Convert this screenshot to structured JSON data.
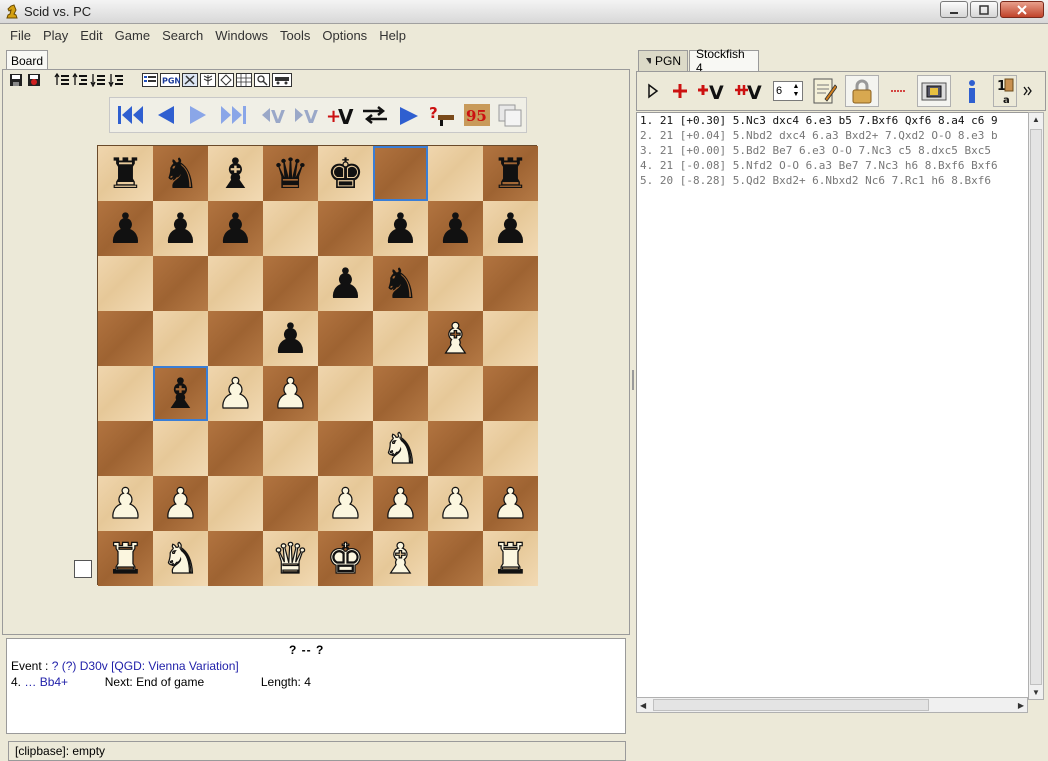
{
  "window": {
    "title": "Scid vs. PC"
  },
  "menu": [
    "File",
    "Play",
    "Edit",
    "Game",
    "Search",
    "Windows",
    "Tools",
    "Options",
    "Help"
  ],
  "left_tab": "Board",
  "board": {
    "rows": [
      [
        "br",
        "bn",
        "bb",
        "bq",
        "bk",
        "",
        "",
        "br"
      ],
      [
        "bp",
        "bp",
        "bp",
        "",
        "",
        "bp",
        "bp",
        "bp"
      ],
      [
        "",
        "",
        "",
        "",
        "bp",
        "bn",
        "",
        ""
      ],
      [
        "",
        "",
        "",
        "bp",
        "",
        "",
        "wb",
        ""
      ],
      [
        "",
        "bb",
        "wp",
        "wp",
        "",
        "",
        "",
        ""
      ],
      [
        "",
        "",
        "",
        "",
        "",
        "wn",
        "",
        ""
      ],
      [
        "wp",
        "wp",
        "",
        "",
        "wp",
        "wp",
        "wp",
        "wp"
      ],
      [
        "wr",
        "wn",
        "",
        "wq",
        "wk",
        "wb",
        "",
        "wr"
      ]
    ],
    "highlights": [
      [
        0,
        5
      ],
      [
        4,
        1
      ]
    ]
  },
  "info": {
    "top": "?   --   ?",
    "event_label": "Event :",
    "event_value": "?",
    "event_paren": "(?)",
    "opening": "D30v [QGD: Vienna Variation]",
    "move_no": "4.",
    "move_dots": "…",
    "move": "Bb4+",
    "next_label": "Next:",
    "next_value": "End of game",
    "length_label": "Length:",
    "length_value": "4"
  },
  "status": {
    "text": "[clipbase]:  empty"
  },
  "right_tabs": {
    "pgn": "PGN",
    "engine": "Stockfish 4"
  },
  "engine": {
    "depth": "6",
    "lines": [
      "1. 21 [+0.30]  5.Nc3 dxc4 6.e3 b5 7.Bxf6 Qxf6 8.a4 c6 9",
      "2. 21 [+0.04]  5.Nbd2 dxc4 6.a3 Bxd2+ 7.Qxd2 O-O 8.e3 b",
      "3. 21 [+0.00]  5.Bd2 Be7 6.e3 O-O 7.Nc3 c5 8.dxc5 Bxc5",
      "4. 21 [-0.08]  5.Nfd2 O-O 6.a3 Be7 7.Nc3 h6 8.Bxf6 Bxf6",
      "5. 20 [-8.28]  5.Qd2 Bxd2+ 6.Nbxd2 Nc6 7.Rc1 h6 8.Bxf6"
    ]
  },
  "colors": {
    "accent_blue": "#2f5fd0",
    "accent_red": "#cc1111"
  }
}
